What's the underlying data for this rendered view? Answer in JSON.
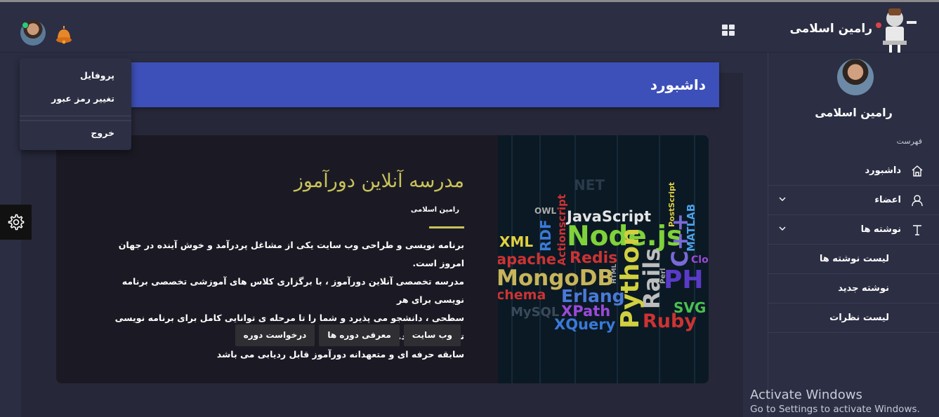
{
  "topbar": {
    "user_name": "رامین اسلامی"
  },
  "header": {
    "title": "داشبورد"
  },
  "sidebar": {
    "user_name": "رامین اسلامی",
    "section_label": "فهرست",
    "items": [
      {
        "label": "داشبورد",
        "icon": "home-icon"
      },
      {
        "label": "اعضاء",
        "icon": "user-icon"
      },
      {
        "label": "نوشته ها",
        "icon": "text-icon"
      }
    ],
    "sub_items": [
      {
        "label": "لیست نوشته ها"
      },
      {
        "label": "نوشته جدید"
      },
      {
        "label": "لیست نظرات"
      }
    ]
  },
  "dropdown": {
    "profile": "پروفایل",
    "change_password": "تغییر رمز عبور",
    "logout": "خروج"
  },
  "card": {
    "title": "مدرسه آنلاین دورآموز",
    "author": "رامین اسلامی",
    "description_lines": [
      "برنامه نویسی و طراحی وب سایت یکی از مشاغل پردرآمد و خوش آینده در جهان امروز است.",
      "مدرسه تخصصی آنلاین دورآموز ، با برگزاری کلاس های آموزشی تخصصی برنامه نویسی برای هر",
      "سطحی ، دانشجو می پذیرد و شما را تا مرحله ی توانایی کامل برای برنامه نویسی تنها نمی گذارد.",
      "سابقه حرفه ای و متعهدانه دورآموز قابل ردیابی می باشد"
    ],
    "buttons": [
      "وب سایت",
      "معرفی دوره ها",
      "درخواست دوره"
    ],
    "image_words": [
      "NET",
      "OWL",
      "JavaScript",
      "RDF",
      "Actionscript",
      "Node.js",
      "PostScript",
      "MATLAB",
      "XML",
      "Redis",
      "C++",
      "Clo",
      "apache",
      "MongoDB",
      "HTML",
      "Rails",
      "PH",
      "chema",
      "Erlang",
      "Python",
      "Perl",
      "MySQL",
      "XPath",
      "SVG",
      "XQuery",
      "Ruby"
    ]
  },
  "system": {
    "activate_title": "Activate Windows",
    "activate_sub": "Go to Settings to activate Windows."
  },
  "colors": {
    "accent": "#3d4fb8",
    "card_title": "#c9c35a",
    "background": "#2b2d42"
  }
}
